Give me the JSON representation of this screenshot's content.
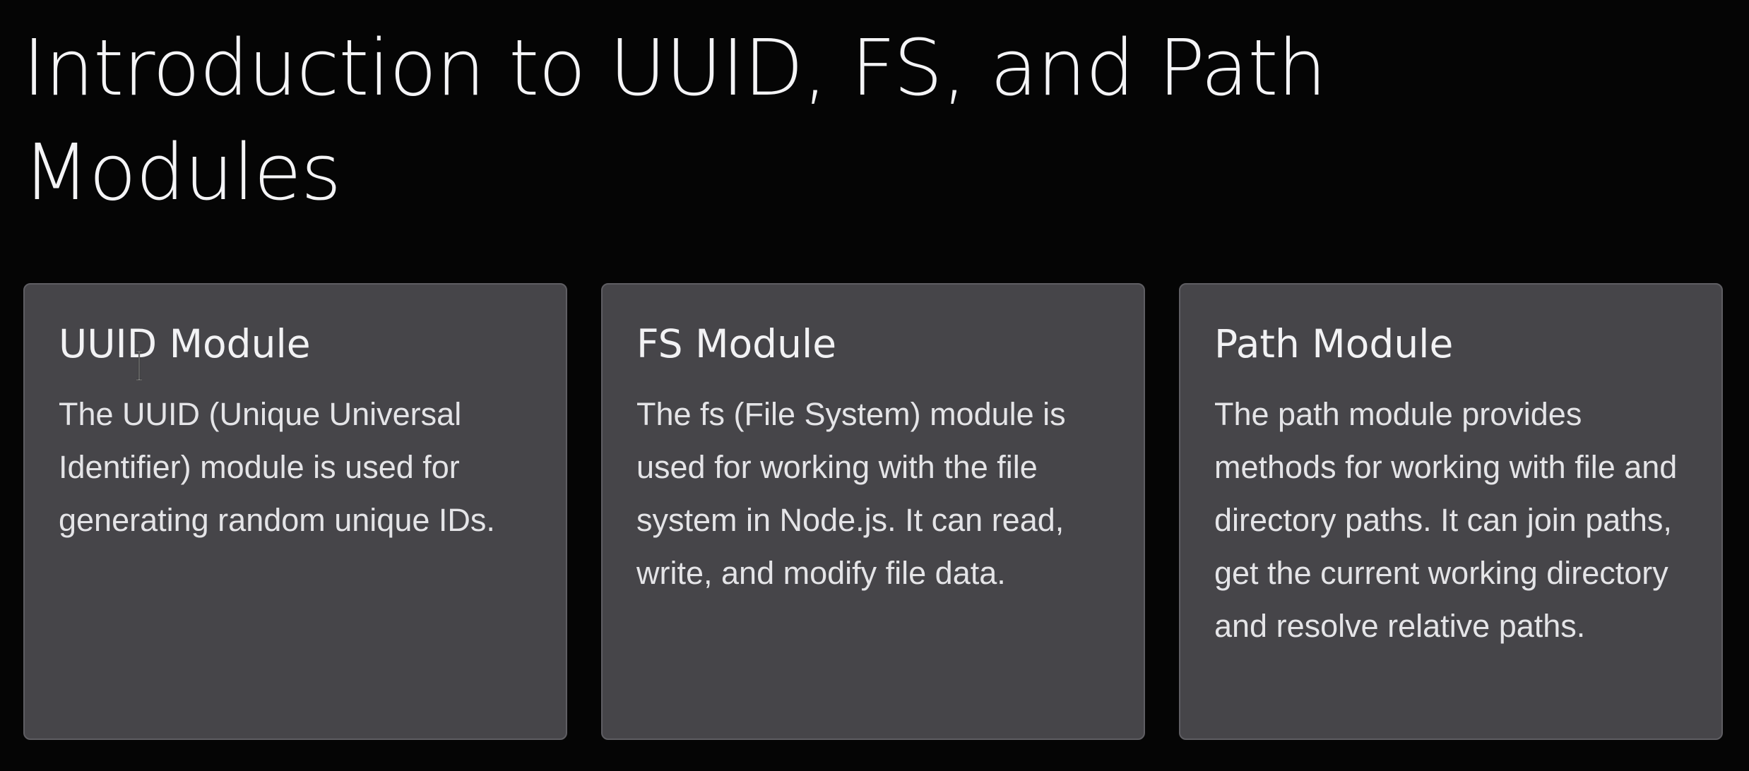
{
  "slide": {
    "title": "Introduction to UUID, FS, and Path Modules"
  },
  "cards": [
    {
      "title": "UUID Module",
      "description": "The UUID (Unique Universal Identifier) module is used for generating random unique IDs."
    },
    {
      "title": "FS Module",
      "description": "The fs (File System) module is used for working with the file system in Node.js. It can read, write, and modify file data."
    },
    {
      "title": "Path Module",
      "description": "The path module provides methods for working with file and directory paths. It can join paths, get the current working directory and resolve relative paths."
    }
  ],
  "cursor": {
    "icon": "text-cursor-icon"
  }
}
